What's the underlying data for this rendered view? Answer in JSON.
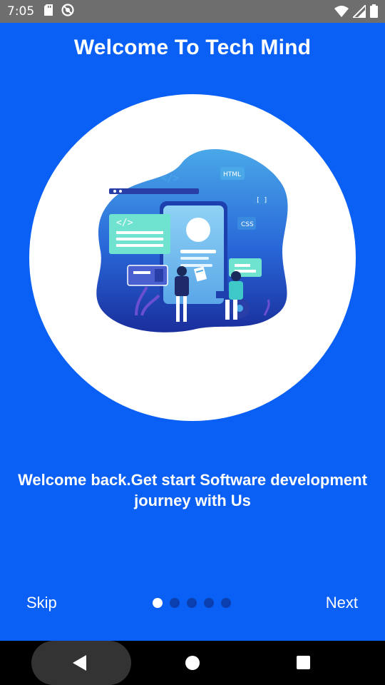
{
  "status_bar": {
    "time": "7:05",
    "icons": [
      "sd-card-icon",
      "no-disturb-icon",
      "wifi-icon",
      "signal-icon",
      "battery-icon"
    ]
  },
  "header": {
    "title": "Welcome To Tech Mind"
  },
  "illustration": {
    "code_tag": "</>",
    "html_tag": "HTML",
    "css_tag": "CSS",
    "brackets_tag": "[ ]"
  },
  "content": {
    "subtitle": "Welcome back.Get start Software development journey with Us"
  },
  "footer": {
    "skip_label": "Skip",
    "next_label": "Next",
    "page_count": 5,
    "active_page": 1
  },
  "colors": {
    "background": "#0a5ff5",
    "status_bar": "#6e6e6e",
    "dot_active": "#ffffff",
    "dot_inactive": "#0a3fb0"
  }
}
